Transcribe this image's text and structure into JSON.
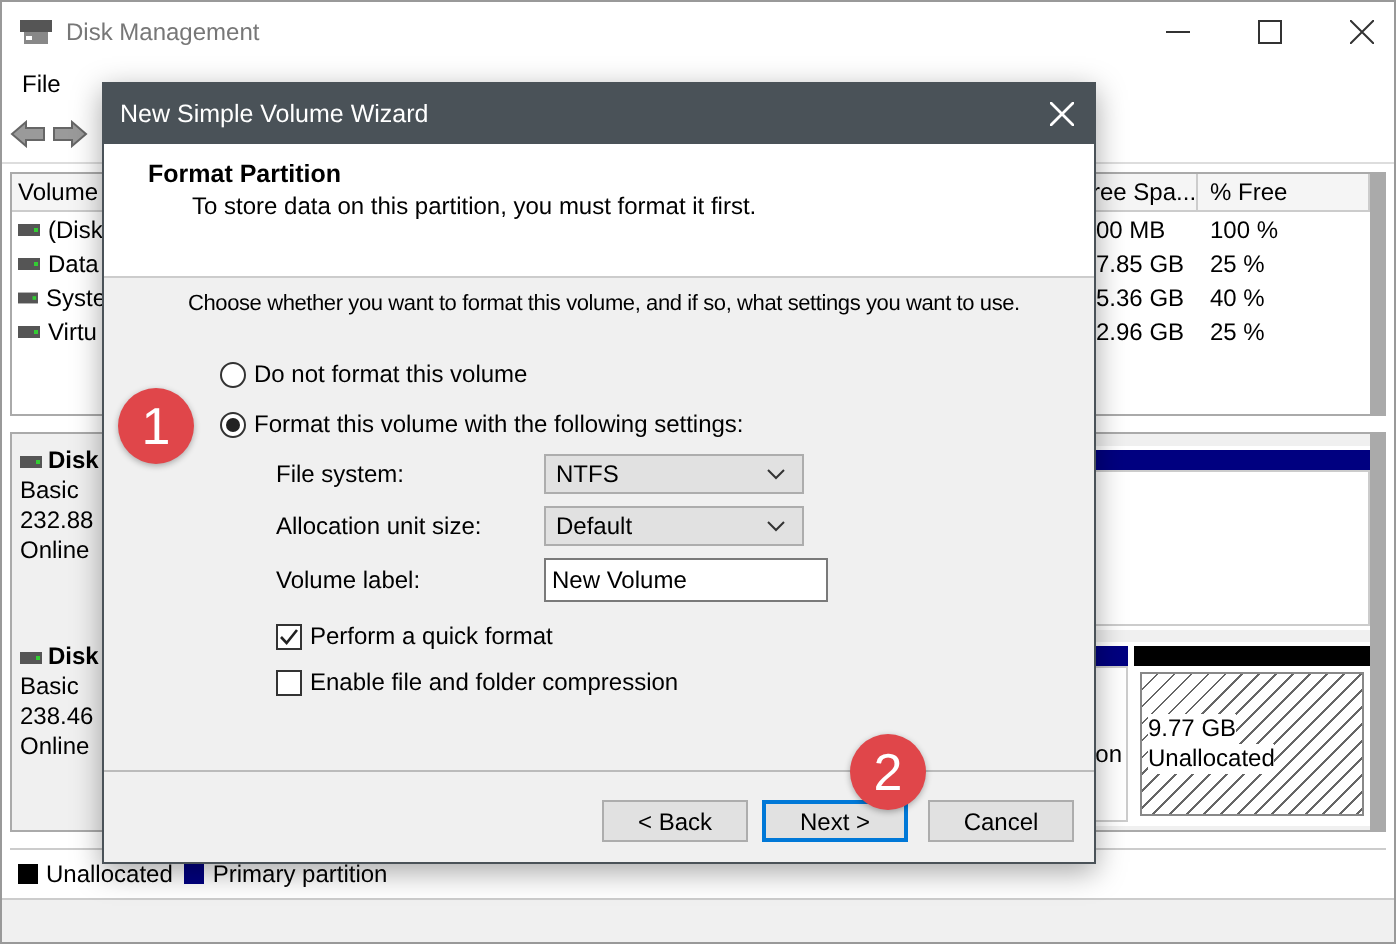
{
  "window": {
    "title": "Disk Management"
  },
  "menu": [
    "File"
  ],
  "volume_table": {
    "columns": [
      "Volume",
      "ree Spa...",
      "% Free"
    ],
    "rows": [
      {
        "volume": "(Disk",
        "free_space": "00 MB",
        "percent_free": "100 %"
      },
      {
        "volume": "Data",
        "free_space": "7.85 GB",
        "percent_free": "25 %"
      },
      {
        "volume": "Syste",
        "free_space": "5.36 GB",
        "percent_free": "40 %"
      },
      {
        "volume": "Virtu",
        "free_space": "2.96 GB",
        "percent_free": "25 %"
      }
    ]
  },
  "disks": [
    {
      "name": "Disk",
      "type": "Basic",
      "size": "232.88",
      "status": "Online",
      "segments": [
        {
          "kind": "primary"
        }
      ]
    },
    {
      "name": "Disk",
      "type": "Basic",
      "size": "238.46",
      "status": "Online",
      "segments": [
        {
          "kind": "primary",
          "text": "on"
        },
        {
          "kind": "unallocated",
          "size": "9.77 GB",
          "label": "Unallocated"
        }
      ]
    }
  ],
  "legend": [
    {
      "label": "Unallocated",
      "color": "#000000"
    },
    {
      "label": "Primary partition",
      "color": "#000080"
    }
  ],
  "dialog": {
    "title": "New Simple Volume Wizard",
    "heading": "Format Partition",
    "subtitle": "To store data on this partition, you must format it first.",
    "prompt": "Choose whether you want to format this volume, and if so, what settings you want to use.",
    "options": [
      {
        "label": "Do not format this volume",
        "selected": false
      },
      {
        "label": "Format this volume with the following settings:",
        "selected": true
      }
    ],
    "fields": [
      {
        "kind": "select",
        "label": "File system:",
        "value": "NTFS"
      },
      {
        "kind": "select",
        "label": "Allocation unit size:",
        "value": "Default"
      },
      {
        "kind": "text",
        "label": "Volume label:",
        "value": "New Volume"
      }
    ],
    "checkboxes": [
      {
        "label": "Perform a quick format",
        "checked": true
      },
      {
        "label": "Enable file and folder compression",
        "checked": false
      }
    ],
    "buttons": [
      {
        "label": "< Back",
        "default": false
      },
      {
        "label": "Next >",
        "default": true
      },
      {
        "label": "Cancel",
        "default": false
      }
    ]
  },
  "callouts": [
    "1",
    "2"
  ]
}
